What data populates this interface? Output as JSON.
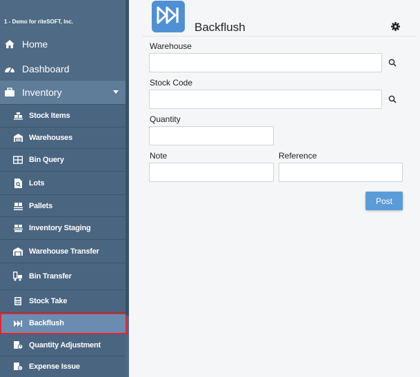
{
  "sidebar": {
    "company": "1 - Demo for riteSOFT, Inc.",
    "top_items": [
      {
        "label": "Home",
        "icon": "home-icon"
      },
      {
        "label": "Dashboard",
        "icon": "dashboard-icon"
      },
      {
        "label": "Inventory",
        "icon": "briefcase-icon",
        "expanded": true
      }
    ],
    "sub_items": [
      {
        "label": "Stock Items",
        "icon": "stock-items-icon"
      },
      {
        "label": "Warehouses",
        "icon": "warehouse-icon"
      },
      {
        "label": "Bin Query",
        "icon": "bin-query-icon"
      },
      {
        "label": "Lots",
        "icon": "lots-icon"
      },
      {
        "label": "Pallets",
        "icon": "pallets-icon"
      },
      {
        "label": "Inventory Staging",
        "icon": "staging-icon"
      },
      {
        "label": "Warehouse Transfer",
        "icon": "warehouse-transfer-icon"
      },
      {
        "label": "Bin Transfer",
        "icon": "bin-transfer-icon"
      },
      {
        "label": "Stock Take",
        "icon": "calculator-icon"
      },
      {
        "label": "Backflush",
        "icon": "fast-forward-icon",
        "selected": true
      },
      {
        "label": "Quantity Adjustment",
        "icon": "adjustment-icon"
      },
      {
        "label": "Expense Issue",
        "icon": "expense-icon"
      }
    ]
  },
  "header": {
    "title": "Backflush",
    "icon": "fast-forward-icon",
    "accent": "#4f90d4"
  },
  "form": {
    "warehouse_label": "Warehouse",
    "warehouse_value": "",
    "stock_code_label": "Stock Code",
    "stock_code_value": "",
    "quantity_label": "Quantity",
    "quantity_value": "",
    "note_label": "Note",
    "note_value": "",
    "reference_label": "Reference",
    "reference_value": "",
    "post_label": "Post"
  },
  "colors": {
    "sidebar": "#4e6a85",
    "selected": "#6b8cb1",
    "highlight_border": "#e5262c",
    "button": "#5b9bd8"
  }
}
